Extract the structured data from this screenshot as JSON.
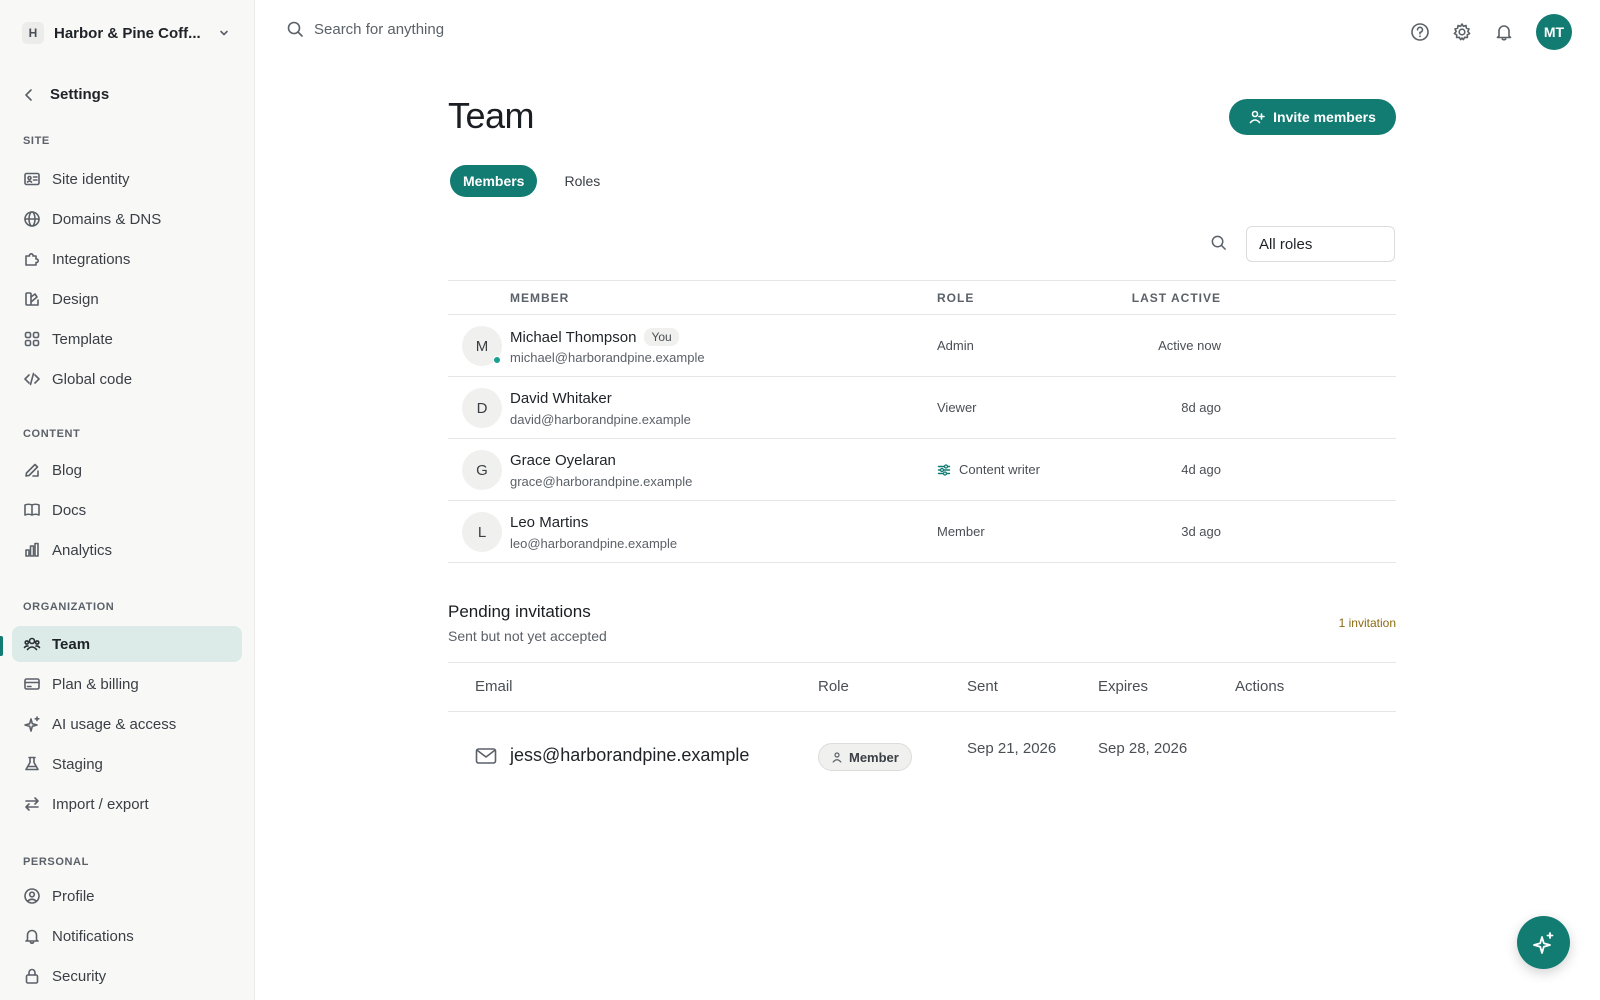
{
  "workspace": {
    "badge": "H",
    "name": "Harbor & Pine Coff..."
  },
  "sidebar": {
    "back_label": "Settings",
    "sections": [
      {
        "label": "SITE",
        "items": [
          {
            "label": "Site identity",
            "icon": "id-card-icon"
          },
          {
            "label": "Domains & DNS",
            "icon": "globe-icon"
          },
          {
            "label": "Integrations",
            "icon": "puzzle-icon"
          },
          {
            "label": "Design",
            "icon": "palette-icon"
          },
          {
            "label": "Template",
            "icon": "template-icon"
          },
          {
            "label": "Global code",
            "icon": "code-icon"
          }
        ]
      },
      {
        "label": "CONTENT",
        "items": [
          {
            "label": "Blog",
            "icon": "pencil-icon"
          },
          {
            "label": "Docs",
            "icon": "book-icon"
          },
          {
            "label": "Analytics",
            "icon": "bar-chart-icon"
          }
        ]
      },
      {
        "label": "ORGANIZATION",
        "items": [
          {
            "label": "Team",
            "icon": "team-icon",
            "active": true
          },
          {
            "label": "Plan & billing",
            "icon": "credit-card-icon"
          },
          {
            "label": "AI usage & access",
            "icon": "sparkles-icon"
          },
          {
            "label": "Staging",
            "icon": "flask-icon"
          },
          {
            "label": "Import / export",
            "icon": "arrows-icon"
          }
        ]
      },
      {
        "label": "PERSONAL",
        "items": [
          {
            "label": "Profile",
            "icon": "user-circle-icon"
          },
          {
            "label": "Notifications",
            "icon": "bell-icon"
          },
          {
            "label": "Security",
            "icon": "lock-icon"
          }
        ]
      }
    ]
  },
  "topbar": {
    "search_placeholder": "Search for anything",
    "user_initials": "MT"
  },
  "page": {
    "title": "Team",
    "invite_label": "Invite members",
    "tabs": [
      {
        "label": "Members",
        "active": true
      },
      {
        "label": "Roles",
        "active": false
      }
    ],
    "role_filter": "All roles"
  },
  "members_table": {
    "headers": {
      "member": "MEMBER",
      "role": "ROLE",
      "last_active": "LAST ACTIVE"
    },
    "rows": [
      {
        "initial": "M",
        "name": "Michael Thompson",
        "badge": "You",
        "email": "michael@harborandpine.example",
        "role": "Admin",
        "last_active": "Active now",
        "online": true
      },
      {
        "initial": "D",
        "name": "David Whitaker",
        "email": "david@harborandpine.example",
        "role": "Viewer",
        "last_active": "8d ago"
      },
      {
        "initial": "G",
        "name": "Grace Oyelaran",
        "email": "grace@harborandpine.example",
        "role": "Content writer",
        "role_icon": "sliders-icon",
        "last_active": "4d ago"
      },
      {
        "initial": "L",
        "name": "Leo Martins",
        "email": "leo@harborandpine.example",
        "role": "Member",
        "last_active": "3d ago"
      }
    ]
  },
  "pending": {
    "title": "Pending invitations",
    "subtitle": "Sent but not yet accepted",
    "count_label": "1 invitation",
    "headers": {
      "email": "Email",
      "role": "Role",
      "sent": "Sent",
      "expires": "Expires",
      "actions": "Actions"
    },
    "rows": [
      {
        "email": "jess@harborandpine.example",
        "role": "Member",
        "sent": "Sep 21, 2026",
        "expires": "Sep 28, 2026"
      }
    ]
  },
  "colors": {
    "accent": "#127b72",
    "active_nav_bg": "#dcebe8",
    "pending_count": "#8a6a12"
  }
}
